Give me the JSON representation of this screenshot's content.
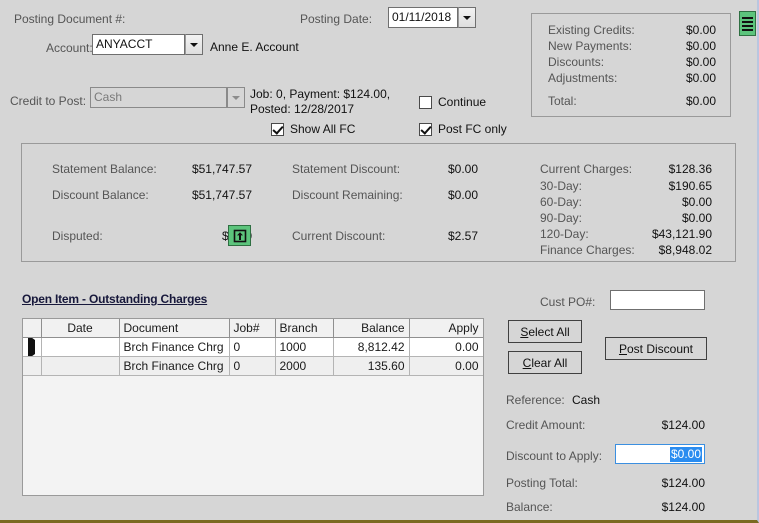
{
  "header": {
    "posting_document_label": "Posting Document #:",
    "posting_document_value": "",
    "account_label": "Account:",
    "account_value": "ANYACCT",
    "account_name": "Anne E. Account",
    "credit_to_post_label": "Credit to Post:",
    "credit_to_post_value": "Cash",
    "credit_info_line1": "Job: 0, Payment: $124.00,",
    "credit_info_line2": "Posted: 12/28/2017",
    "posting_date_label": "Posting Date:",
    "posting_date_value": "01/11/2018",
    "continue_label": "Continue",
    "continue_checked": false,
    "show_all_fc_label": "Show All FC",
    "show_all_fc_checked": true,
    "post_fc_only_label": "Post FC only",
    "post_fc_only_checked": true,
    "list_icon": "list-bars-icon"
  },
  "summary": {
    "rows": [
      {
        "label": "Existing Credits:",
        "value": "$0.00"
      },
      {
        "label": "New Payments:",
        "value": "$0.00"
      },
      {
        "label": "Discounts:",
        "value": "$0.00"
      },
      {
        "label": "Adjustments:",
        "value": "$0.00"
      }
    ],
    "total_label": "Total:",
    "total_value": "$0.00"
  },
  "balances": {
    "statement_balance_label": "Statement Balance:",
    "statement_balance_value": "$51,747.57",
    "discount_balance_label": "Discount Balance:",
    "discount_balance_value": "$51,747.57",
    "disputed_label": "Disputed:",
    "disputed_value": "$0.00",
    "disputed_icon": "upload-box-icon",
    "statement_discount_label": "Statement Discount:",
    "statement_discount_value": "$0.00",
    "discount_remaining_label": "Discount Remaining:",
    "discount_remaining_value": "$0.00",
    "current_discount_label": "Current Discount:",
    "current_discount_value": "$2.57",
    "aging": [
      {
        "label": "Current Charges:",
        "value": "$128.36"
      },
      {
        "label": "30-Day:",
        "value": "$190.65"
      },
      {
        "label": "60-Day:",
        "value": "$0.00"
      },
      {
        "label": "90-Day:",
        "value": "$0.00"
      },
      {
        "label": "120-Day:",
        "value": "$43,121.90"
      },
      {
        "label": "Finance Charges:",
        "value": "$8,948.02"
      }
    ]
  },
  "open_items": {
    "title": "Open Item - Outstanding Charges",
    "columns": [
      "",
      "Date",
      "Document",
      "Job#",
      "Branch",
      "Balance",
      "Apply"
    ],
    "rows": [
      {
        "marker": "current-row-marker",
        "date": "",
        "document": "Brch Finance Chrg",
        "job": "0",
        "branch": "1000",
        "balance": "8,812.42",
        "apply": "0.00"
      },
      {
        "marker": "",
        "date": "",
        "document": "Brch Finance Chrg",
        "job": "0",
        "branch": "2000",
        "balance": "135.60",
        "apply": "0.00"
      }
    ]
  },
  "side": {
    "cust_po_label": "Cust PO#:",
    "cust_po_value": "",
    "select_all_label": "Select All",
    "select_all_accel": "S",
    "clear_all_label": "Clear All",
    "clear_all_accel": "C",
    "post_discount_label": "Post Discount",
    "post_discount_accel": "P",
    "reference_label": "Reference:",
    "reference_value": "Cash",
    "credit_amount_label": "Credit Amount:",
    "credit_amount_value": "$124.00",
    "discount_to_apply_label": "Discount to Apply:",
    "discount_to_apply_value": "$0.00",
    "posting_total_label": "Posting Total:",
    "posting_total_value": "$124.00",
    "balance_label": "Balance:",
    "balance_value": "$124.00"
  },
  "colors": {
    "window_bg": "#d6d6d6",
    "green_icon": "#5cc47c",
    "focus_blue": "#3b8fe0",
    "selection_blue": "#2a8cf0",
    "title_navy": "#17183b"
  }
}
